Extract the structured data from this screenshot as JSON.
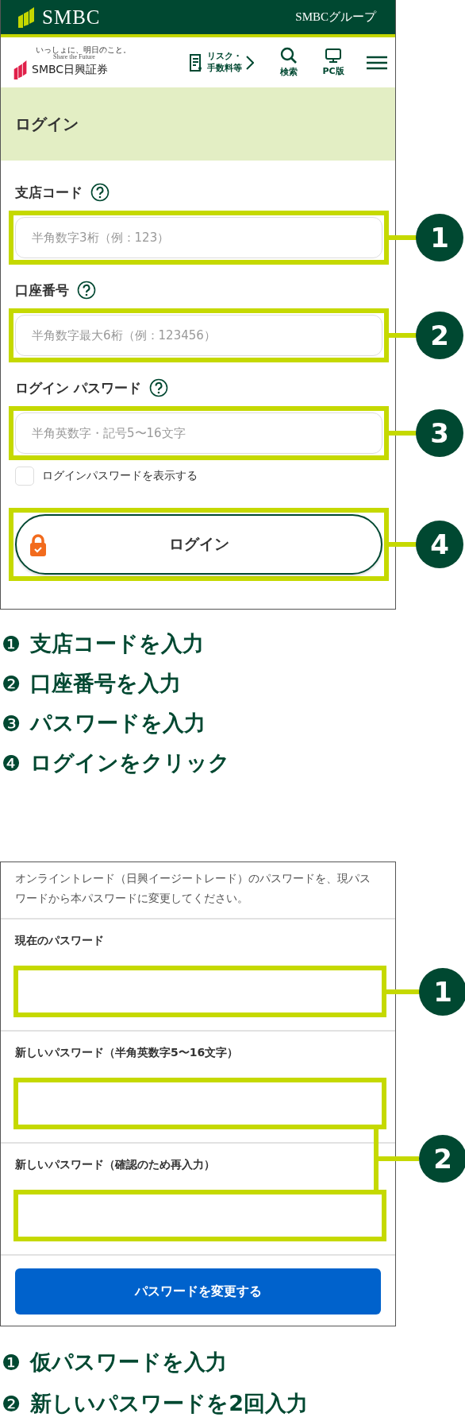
{
  "login_screen": {
    "group_bar": {
      "brand": "SMBC",
      "group": "SMBCグループ"
    },
    "nav": {
      "tagline": "いっしょに、明日のこと。",
      "tagline_en": "Share the Future",
      "company": "SMBC日興証券",
      "risk_link_lines": [
        "リスク・",
        "手数料等"
      ],
      "search": "検索",
      "pc": "PC版"
    },
    "title": "ログイン",
    "fields": [
      {
        "label": "支店コード",
        "placeholder": "半角数字3桁（例：123）",
        "marker": "1"
      },
      {
        "label": "口座番号",
        "placeholder": "半角数字最大6桁（例：123456）",
        "marker": "2"
      },
      {
        "label": "ログイン パスワード",
        "placeholder": "半角英数字・記号5〜16文字",
        "marker": "3"
      }
    ],
    "show_password": {
      "label": "ログインパスワードを表示する",
      "checked": false
    },
    "login_button": {
      "label": "ログイン",
      "marker": "4"
    }
  },
  "login_steps": [
    {
      "number": "❶",
      "text": "支店コードを入力"
    },
    {
      "number": "❷",
      "text": "口座番号を入力"
    },
    {
      "number": "❸",
      "text": "パスワードを入力"
    },
    {
      "number": "❹",
      "text": "ログインをクリック"
    }
  ],
  "password_screen": {
    "notice": "オンライントレード（日興イージートレード）のパスワードを、現パスワードから本パスワードに変更してください。",
    "fields": [
      {
        "label": "現在のパスワード"
      },
      {
        "label": "新しいパスワード（半角英数字5〜16文字）"
      },
      {
        "label": "新しいパスワード（確認のため再入力）"
      }
    ],
    "markers": [
      "1",
      "2"
    ],
    "submit": "パスワードを変更する"
  },
  "password_steps": [
    {
      "number": "❶",
      "text": "仮パスワードを入力"
    },
    {
      "number": "❷",
      "text": "新しいパスワードを2回入力"
    }
  ]
}
